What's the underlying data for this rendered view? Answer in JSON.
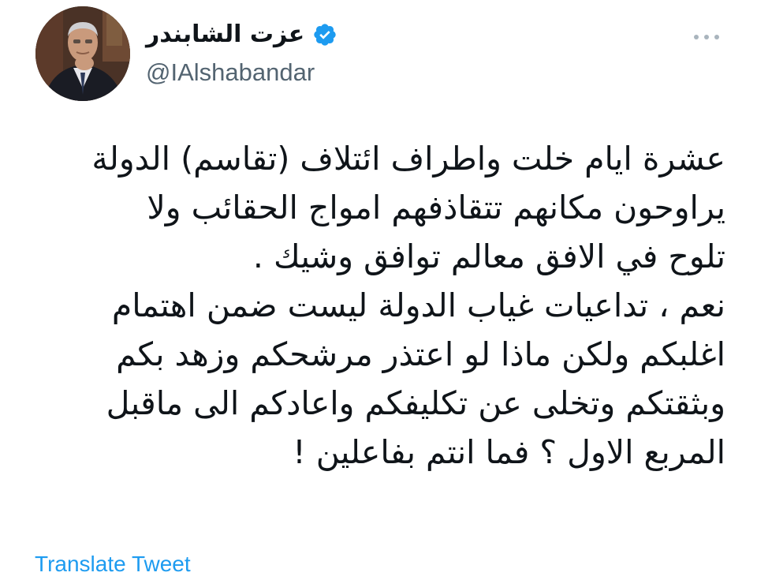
{
  "author": {
    "display_name": "عزت الشابندر",
    "handle": "@IAlshabandar",
    "verified": true,
    "verified_icon": "verified-badge-icon",
    "avatar": "profile-photo"
  },
  "tweet": {
    "lines": [
      "عشرة ايام خلت واطراف ائتلاف (تقاسم) الدولة",
      "يراوحون مكانهم تتقاذفهم امواج الحقائب ولا",
      "تلوح في الافق معالم توافق وشيك .",
      "نعم ، تداعيات غياب الدولة ليست ضمن اهتمام",
      "اغلبكم ولكن ماذا لو اعتذر  مرشحكم وزهد بكم",
      "وبثقتكم وتخلى عن تكليفكم واعادكم الى ماقبل",
      "المربع الاول ؟ فما انتم بفاعلين !"
    ]
  },
  "actions": {
    "translate_label": "Translate Tweet",
    "more_icon": "more-options-icon"
  },
  "colors": {
    "text": "#0f1419",
    "secondary": "#536471",
    "link": "#1d9bf0",
    "verified": "#1d9bf0",
    "more_dots": "#a9b4bd"
  }
}
